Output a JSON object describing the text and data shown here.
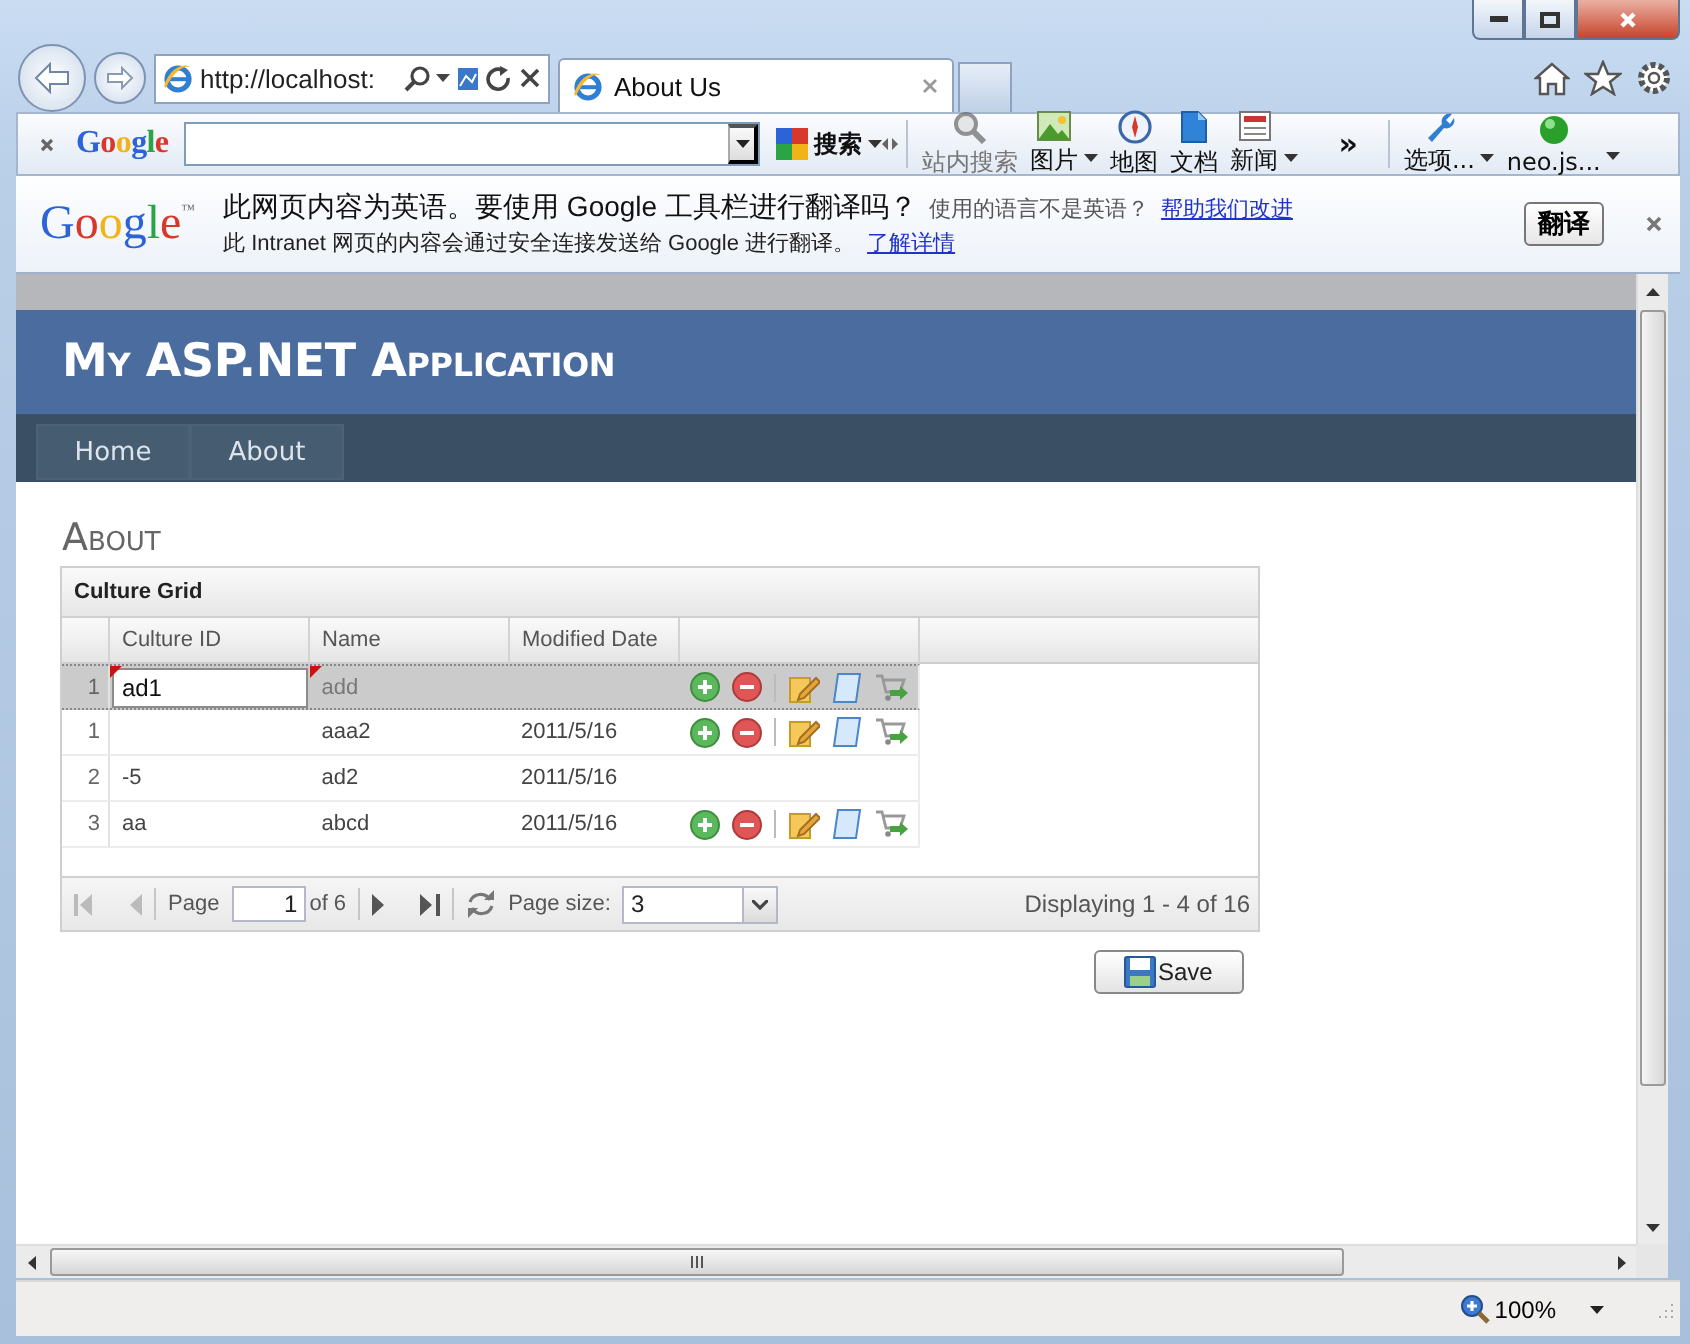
{
  "browser": {
    "address": "http://localhost:",
    "tabs": [
      {
        "label": "About Us",
        "selected": true
      }
    ]
  },
  "google_toolbar": {
    "logo": "Google",
    "search_button": "搜索",
    "items": [
      {
        "kind": "site-search",
        "label": "站内搜索",
        "disabled": true,
        "dropdown": false
      },
      {
        "kind": "images",
        "label": "图片",
        "disabled": false,
        "dropdown": true
      },
      {
        "kind": "maps",
        "label": "地图",
        "disabled": false,
        "dropdown": false
      },
      {
        "kind": "docs",
        "label": "文档",
        "disabled": false,
        "dropdown": false
      },
      {
        "kind": "news",
        "label": "新闻",
        "disabled": false,
        "dropdown": true
      }
    ],
    "more": "»",
    "options": "选项...",
    "account": "neo.js..."
  },
  "translate_bar": {
    "logo": "Google",
    "trademark": "™",
    "message": "此网页内容为英语。要使用 Google 工具栏进行翻译吗？",
    "question": "使用的语言不是英语？",
    "improve_link": "帮助我们改进",
    "note": "此 Intranet 网页的内容会通过安全连接发送给 Google 进行翻译。",
    "details_link": "了解详情",
    "translate_button": "翻译"
  },
  "page": {
    "title": "My ASP.NET Application",
    "menu": [
      {
        "label": "Home"
      },
      {
        "label": "About"
      }
    ],
    "heading": "About",
    "grid": {
      "title": "Culture Grid",
      "columns": [
        "Culture ID",
        "Name",
        "Modified Date"
      ],
      "rows": [
        {
          "number": "1",
          "culture_id": "ad1",
          "name": "add",
          "selected": true,
          "editing": true,
          "dirty": true,
          "actions": true
        },
        {
          "number": "1",
          "name": "aaa2",
          "modified_date": "2011/5/16",
          "selected": false,
          "editing": false,
          "dirty": false,
          "actions": true
        },
        {
          "number": "2",
          "culture_id": "-5",
          "name": "ad2",
          "modified_date": "2011/5/16",
          "selected": false,
          "editing": false,
          "dirty": false,
          "actions": false
        },
        {
          "number": "3",
          "culture_id": "aa",
          "name": "abcd",
          "modified_date": "2011/5/16",
          "selected": false,
          "editing": false,
          "dirty": false,
          "actions": true
        }
      ],
      "pager": {
        "page_label": "Page",
        "page": "1",
        "page_count": "of 6",
        "page_size_label": "Page size:",
        "page_size": "3",
        "summary": "Displaying 1 - 4 of 16"
      }
    },
    "save_button": "Save"
  },
  "status_bar": {
    "zoom": "100%"
  }
}
